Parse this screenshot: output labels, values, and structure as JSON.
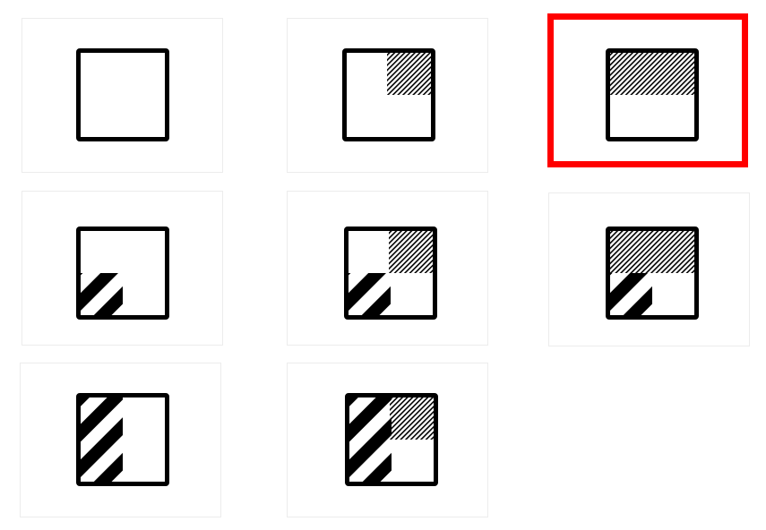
{
  "grid": {
    "selection_color": "#ff0000",
    "selected_card": 2,
    "cards": [
      {
        "id": "empty",
        "fine_top_right": false,
        "fine_top_band": false,
        "coarse_bottom_left": false,
        "coarse_left_column": false
      },
      {
        "id": "fine-top-right",
        "fine_top_right": true,
        "fine_top_band": false,
        "coarse_bottom_left": false,
        "coarse_left_column": false
      },
      {
        "id": "fine-top-band",
        "fine_top_right": false,
        "fine_top_band": true,
        "coarse_bottom_left": false,
        "coarse_left_column": false
      },
      {
        "id": "coarse-bottom-left",
        "fine_top_right": false,
        "fine_top_band": false,
        "coarse_bottom_left": true,
        "coarse_left_column": false
      },
      {
        "id": "fine-top-right-coarse-bottom-left",
        "fine_top_right": true,
        "fine_top_band": false,
        "coarse_bottom_left": true,
        "coarse_left_column": false
      },
      {
        "id": "fine-top-band-coarse-bottom-left",
        "fine_top_right": false,
        "fine_top_band": true,
        "coarse_bottom_left": true,
        "coarse_left_column": false
      },
      {
        "id": "coarse-left-column",
        "fine_top_right": false,
        "fine_top_band": false,
        "coarse_bottom_left": false,
        "coarse_left_column": true
      },
      {
        "id": "coarse-left-column-fine-top-right",
        "fine_top_right": true,
        "fine_top_band": false,
        "coarse_bottom_left": false,
        "coarse_left_column": true
      }
    ]
  }
}
